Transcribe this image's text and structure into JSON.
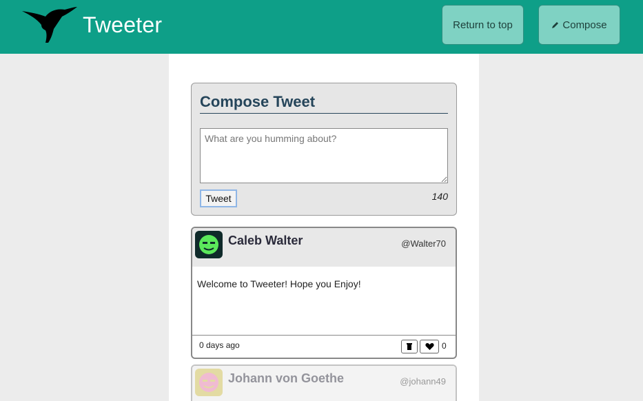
{
  "header": {
    "brand": "Tweeter",
    "return_label": "Return to top",
    "compose_label": "Compose",
    "logo_icon": "hummingbird-icon",
    "compose_icon": "pencil-icon",
    "bg_color": "#0e9f88",
    "button_color": "#7fd2c3"
  },
  "composer": {
    "title": "Compose Tweet",
    "placeholder": "What are you humming about?",
    "value": "",
    "submit_label": "Tweet",
    "char_count": "140"
  },
  "tweets": [
    {
      "name": "Caleb Walter",
      "handle": "@Walter70",
      "text": "Welcome to Tweeter! Hope you Enjoy!",
      "time": "0 days ago",
      "likes": "0",
      "avatar_icon": "green-face-avatar-icon"
    },
    {
      "name": "Johann von Goethe",
      "handle": "@johann49",
      "avatar_icon": "pink-face-avatar-icon"
    }
  ]
}
